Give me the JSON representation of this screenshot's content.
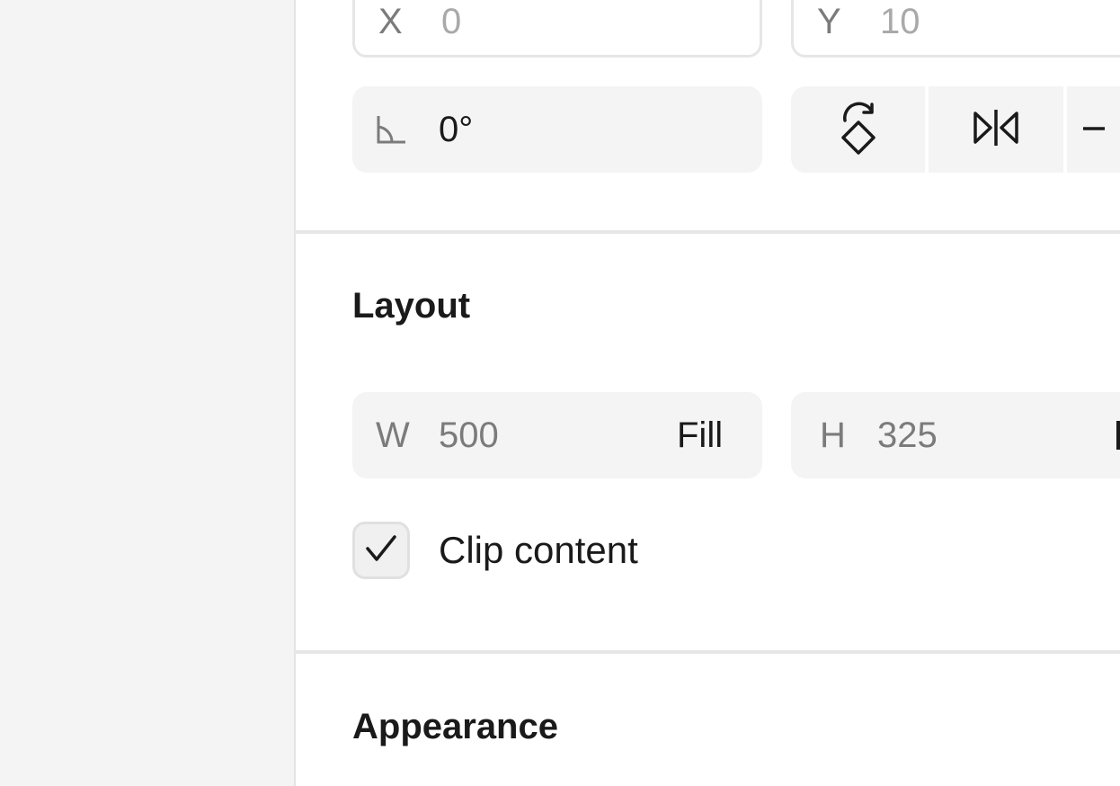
{
  "transform": {
    "x": {
      "label": "X",
      "value": "0"
    },
    "y": {
      "label": "Y",
      "value": "10"
    },
    "rotation": {
      "icon": "angle-icon",
      "value": "0°"
    },
    "buttons": [
      {
        "name": "rotate-button",
        "icon": "rotate-icon"
      },
      {
        "name": "flip-horizontal-button",
        "icon": "flip-horizontal-icon"
      },
      {
        "name": "flip-vertical-button",
        "icon": "flip-vertical-icon"
      }
    ]
  },
  "layout": {
    "title": "Layout",
    "width": {
      "label": "W",
      "value": "500",
      "mode": "Fill"
    },
    "height": {
      "label": "H",
      "value": "325"
    },
    "clip_content": {
      "label": "Clip content",
      "checked": true
    }
  },
  "appearance": {
    "title": "Appearance"
  },
  "colors": {
    "panel_bg": "#ffffff",
    "canvas_bg": "#f4f4f4",
    "field_bg": "#f4f4f4",
    "text": "#1a1a1a",
    "muted": "#a9a9a9"
  }
}
